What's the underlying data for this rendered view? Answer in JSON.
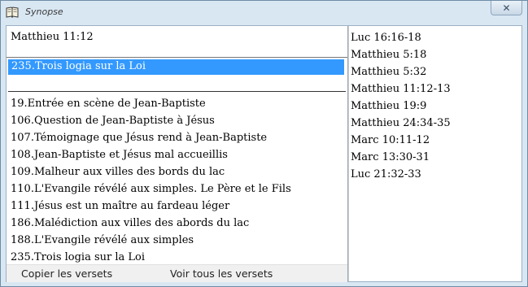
{
  "window": {
    "title": "Synopse",
    "close_label": "✕"
  },
  "icons": {
    "app": "book-icon",
    "close": "close-icon"
  },
  "reference_field": {
    "value": "Matthieu 11:12"
  },
  "selected_pericope": "235.Trois logia sur la Loi",
  "pericopes": [
    "19.Entrée en scène de Jean-Baptiste",
    "106.Question de Jean-Baptiste à Jésus",
    "107.Témoignage que Jésus rend à Jean-Baptiste",
    "108.Jean-Baptiste et Jésus mal accueillis",
    "109.Malheur aux villes des bords du lac",
    "110.L'Evangile révélé aux simples. Le Père et le Fils",
    "111.Jésus est un maître au fardeau léger",
    "186.Malédiction aux villes des abords du lac",
    "188.L'Evangile révélé aux simples",
    "235.Trois logia sur la Loi"
  ],
  "toolbar": {
    "copy_label": "Copier les versets",
    "show_all_label": "Voir tous les versets"
  },
  "parallel_references": [
    "Luc 16:16-18",
    "Matthieu 5:18",
    "Matthieu 5:32",
    "Matthieu 11:12-13",
    "Matthieu 19:9",
    "Matthieu 24:34-35",
    "Marc 10:11-12",
    "Marc 13:30-31",
    "Luc 21:32-33"
  ],
  "colors": {
    "selection": "#3399ff",
    "frame": "#d9e7f3"
  }
}
